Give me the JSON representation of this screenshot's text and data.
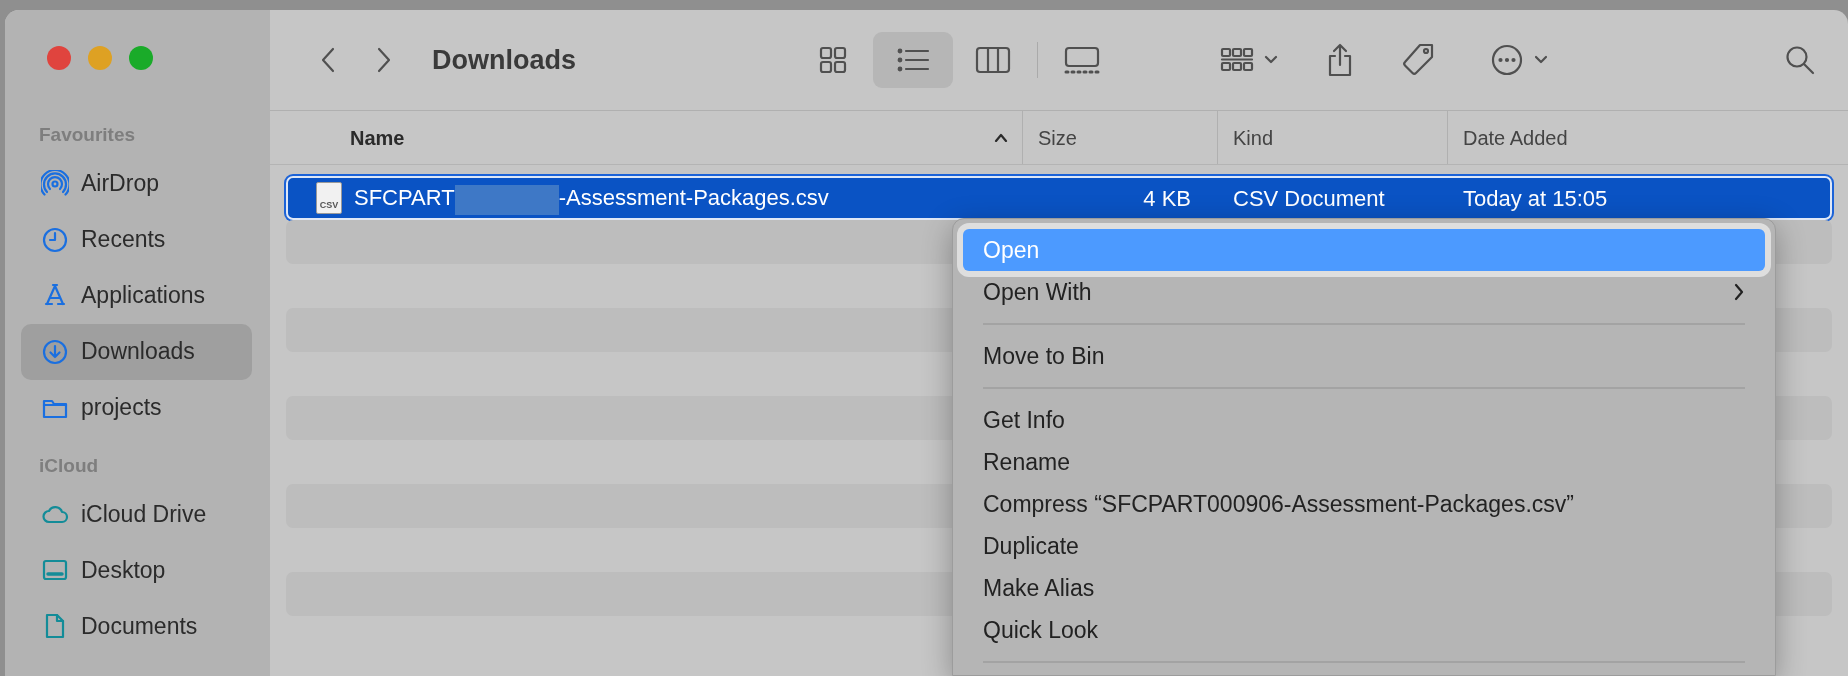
{
  "window": {
    "title": "Downloads",
    "controls": [
      {
        "color": "#e0443e"
      },
      {
        "color": "#dea123"
      },
      {
        "color": "#1aab29"
      }
    ]
  },
  "toolbar": {
    "views": [
      {
        "kind": "icons",
        "selected": false
      },
      {
        "kind": "list",
        "selected": true
      },
      {
        "kind": "columns",
        "selected": false
      },
      {
        "kind": "gallery",
        "selected": false
      }
    ]
  },
  "sidebar": {
    "sections": [
      {
        "heading": "Favourites",
        "items": [
          {
            "label": "AirDrop",
            "kind": "airdrop",
            "selected": false
          },
          {
            "label": "Recents",
            "kind": "clock",
            "selected": false
          },
          {
            "label": "Applications",
            "kind": "apps",
            "selected": false
          },
          {
            "label": "Downloads",
            "kind": "download",
            "selected": true
          },
          {
            "label": "projects",
            "kind": "folder",
            "selected": false
          }
        ]
      },
      {
        "heading": "iCloud",
        "items": [
          {
            "label": "iCloud Drive",
            "kind": "cloud",
            "selected": false
          },
          {
            "label": "Desktop",
            "kind": "desktop",
            "selected": false
          },
          {
            "label": "Documents",
            "kind": "document",
            "selected": false
          }
        ]
      }
    ]
  },
  "table": {
    "columns": [
      {
        "label": "Name",
        "sorted": true
      },
      {
        "label": "Size",
        "sorted": false
      },
      {
        "label": "Kind",
        "sorted": false
      },
      {
        "label": "Date Added",
        "sorted": false
      }
    ],
    "rows": [
      {
        "icon_label": "CSV",
        "name_prefix": "SFCPART",
        "redacted": true,
        "name_suffix": "-Assessment-Packages.csv",
        "size": "4 KB",
        "kind_label": "CSV Document",
        "date_added": "Today at 15:05",
        "selected": true
      }
    ]
  },
  "context_menu": {
    "items": [
      {
        "kind": "item",
        "label": "Open",
        "selected": true,
        "submenu": false
      },
      {
        "kind": "item",
        "label": "Open With",
        "selected": false,
        "submenu": true
      },
      {
        "kind": "separator"
      },
      {
        "kind": "item",
        "label": "Move to Bin",
        "selected": false,
        "submenu": false
      },
      {
        "kind": "separator"
      },
      {
        "kind": "item",
        "label": "Get Info",
        "selected": false,
        "submenu": false
      },
      {
        "kind": "item",
        "label": "Rename",
        "selected": false,
        "submenu": false
      },
      {
        "kind": "item",
        "label": "Compress “SFCPART000906-Assessment-Packages.csv”",
        "selected": false,
        "submenu": false
      },
      {
        "kind": "item",
        "label": "Duplicate",
        "selected": false,
        "submenu": false
      },
      {
        "kind": "item",
        "label": "Make Alias",
        "selected": false,
        "submenu": false
      },
      {
        "kind": "item",
        "label": "Quick Look",
        "selected": false,
        "submenu": false
      },
      {
        "kind": "separator"
      }
    ]
  }
}
